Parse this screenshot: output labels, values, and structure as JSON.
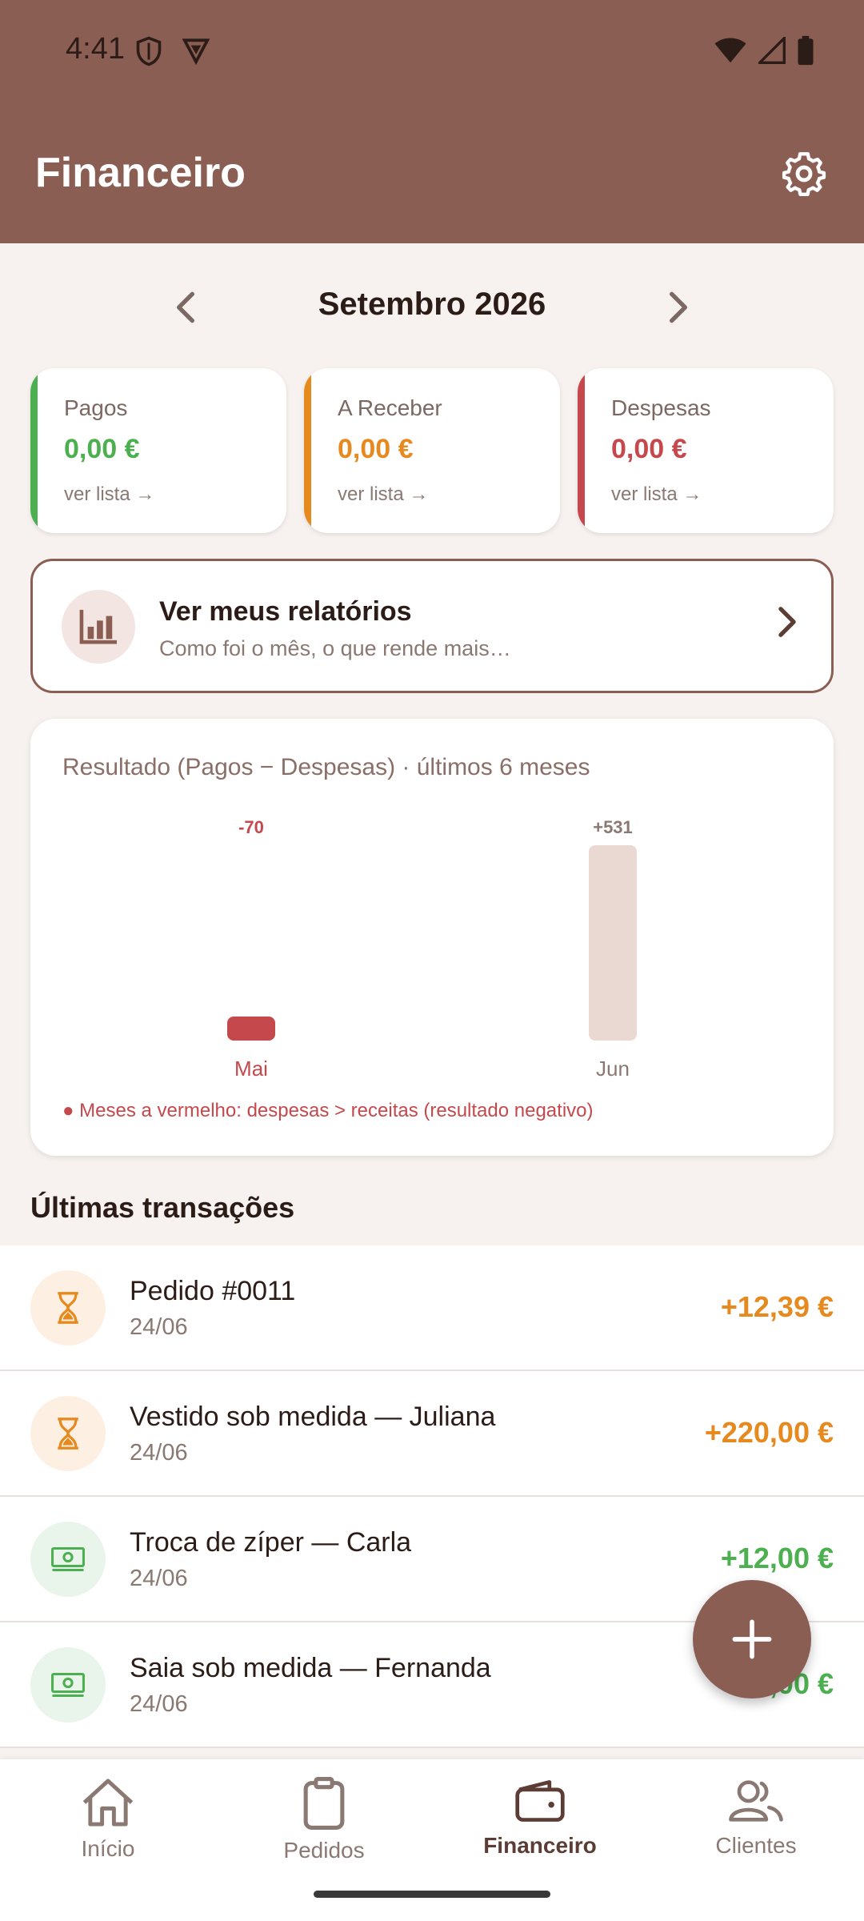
{
  "status_bar": {
    "time": "4:41"
  },
  "header": {
    "title": "Financeiro"
  },
  "month_nav": {
    "label": "Setembro 2026"
  },
  "summary": [
    {
      "label": "Pagos",
      "amount": "0,00 €",
      "link": "ver lista →",
      "color": "#4caf50"
    },
    {
      "label": "A Receber",
      "amount": "0,00 €",
      "link": "ver lista →",
      "color": "#e68a1f"
    },
    {
      "label": "Despesas",
      "amount": "0,00 €",
      "link": "ver lista →",
      "color": "#c5484c"
    }
  ],
  "reports": {
    "title": "Ver meus relatórios",
    "subtitle": "Como foi o mês, o que rende mais…"
  },
  "chart_data": {
    "type": "bar",
    "title": "Resultado (Pagos − Despesas) · últimos 6 meses",
    "categories": [
      "Mai",
      "Jun"
    ],
    "values": [
      -70,
      531
    ],
    "value_labels": [
      "-70",
      "+531"
    ],
    "note": "● Meses a vermelho: despesas > receitas (resultado negativo)",
    "colors": {
      "negative": "#c5484c",
      "positive": "#ead8d2"
    }
  },
  "transactions_title": "Últimas transações",
  "transactions": [
    {
      "name": "Pedido #0011",
      "date": "24/06",
      "amount": "+12,39 €",
      "icon": "hourglass-icon",
      "kind": "pending"
    },
    {
      "name": "Vestido sob medida — Juliana",
      "date": "24/06",
      "amount": "+220,00 €",
      "icon": "hourglass-icon",
      "kind": "pending"
    },
    {
      "name": "Troca de zíper — Carla",
      "date": "24/06",
      "amount": "+12,00 €",
      "icon": "cash-icon",
      "kind": "paid"
    },
    {
      "name": "Saia sob medida — Fernanda",
      "date": "24/06",
      "amount": "+50,00 €",
      "icon": "cash-icon",
      "kind": "paid"
    }
  ],
  "nav": [
    {
      "label": "Início",
      "icon": "home-icon"
    },
    {
      "label": "Pedidos",
      "icon": "clipboard-icon"
    },
    {
      "label": "Financeiro",
      "icon": "wallet-icon",
      "active": true
    },
    {
      "label": "Clientes",
      "icon": "users-icon"
    }
  ],
  "colors": {
    "header": "#8b5e54",
    "pending": "#e68a1f",
    "paid": "#4caf50"
  }
}
